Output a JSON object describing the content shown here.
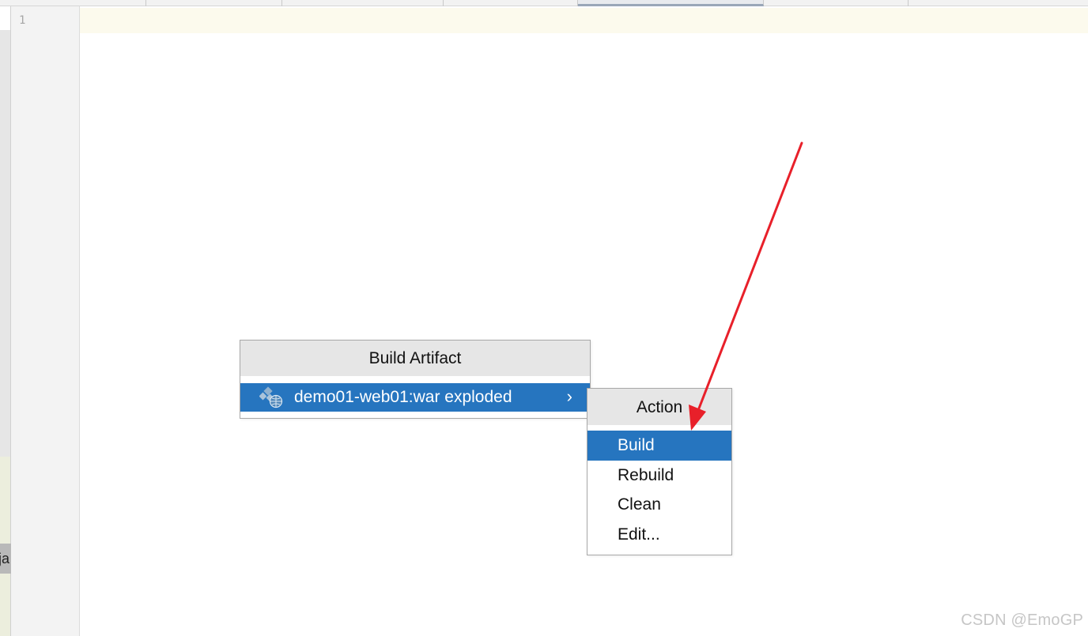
{
  "editor": {
    "line_numbers": [
      "1"
    ],
    "left_strip_label": "ja"
  },
  "artifact_popup": {
    "title": "Build Artifact",
    "items": [
      {
        "label": "demo01-web01:war exploded",
        "icon": "web-artifact-icon",
        "submenu_arrow": "›",
        "selected": true
      }
    ]
  },
  "action_popup": {
    "title": "Action",
    "items": [
      {
        "label": "Build",
        "selected": true
      },
      {
        "label": "Rebuild",
        "selected": false
      },
      {
        "label": "Clean",
        "selected": false
      },
      {
        "label": "Edit...",
        "selected": false
      }
    ]
  },
  "watermark": "CSDN @EmoGP",
  "colors": {
    "selection": "#2675bf",
    "popup_header": "#e6e6e6",
    "caret_line": "#fcfaed",
    "annotation_arrow": "#e8202a"
  }
}
